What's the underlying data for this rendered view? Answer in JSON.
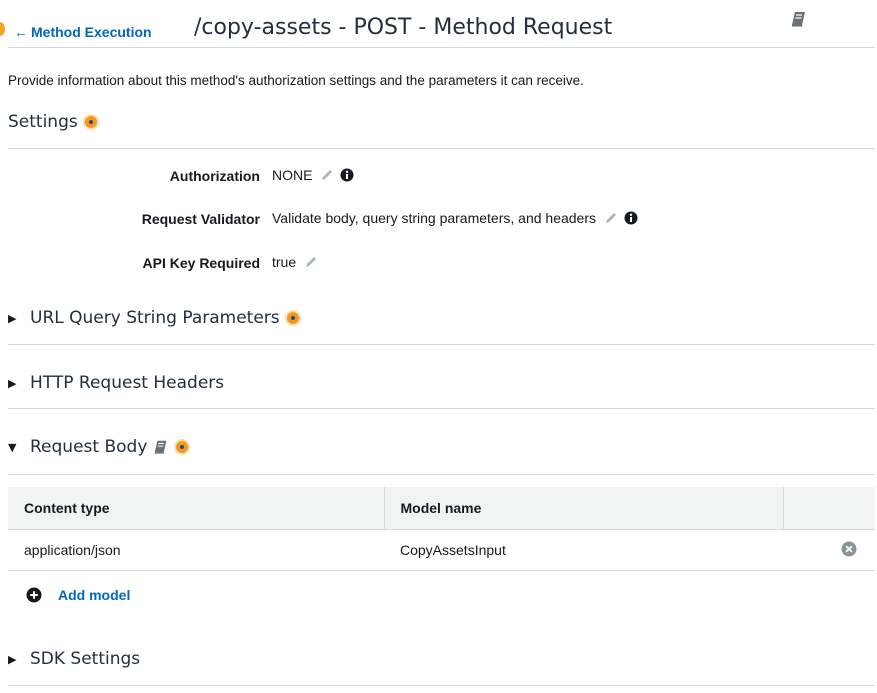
{
  "header": {
    "back_link": "Method Execution",
    "title": "/copy-assets - POST - Method Request"
  },
  "description": "Provide information about this method's authorization settings and the parameters it can receive.",
  "settings": {
    "title": "Settings",
    "rows": [
      {
        "label": "Authorization",
        "value": "NONE",
        "has_info": true
      },
      {
        "label": "Request Validator",
        "value": "Validate body, query string parameters, and headers",
        "has_info": true
      },
      {
        "label": "API Key Required",
        "value": "true",
        "has_info": false
      }
    ]
  },
  "sections": {
    "url_query": {
      "title": "URL Query String Parameters",
      "expanded": false
    },
    "http_headers": {
      "title": "HTTP Request Headers",
      "expanded": false
    },
    "request_body": {
      "title": "Request Body",
      "expanded": true
    },
    "sdk_settings": {
      "title": "SDK Settings",
      "expanded": false
    }
  },
  "request_body_table": {
    "columns": [
      "Content type",
      "Model name",
      ""
    ],
    "rows": [
      {
        "content_type": "application/json",
        "model_name": "CopyAssetsInput"
      }
    ]
  },
  "add_model": {
    "label": "Add model"
  },
  "icons": {
    "back": "arrow-left-icon",
    "docs": "book-icon",
    "edit": "pencil-icon",
    "info": "info-icon",
    "help": "help-dot-icon",
    "collapsed": "caret-right-icon",
    "expanded": "caret-down-icon",
    "remove": "remove-circle-icon",
    "add": "plus-circle-icon"
  },
  "colors": {
    "link": "#0066c0",
    "help_dot": "#f7981d",
    "divider": "#d5d9dc",
    "table_header_bg": "#f2f3f3"
  }
}
